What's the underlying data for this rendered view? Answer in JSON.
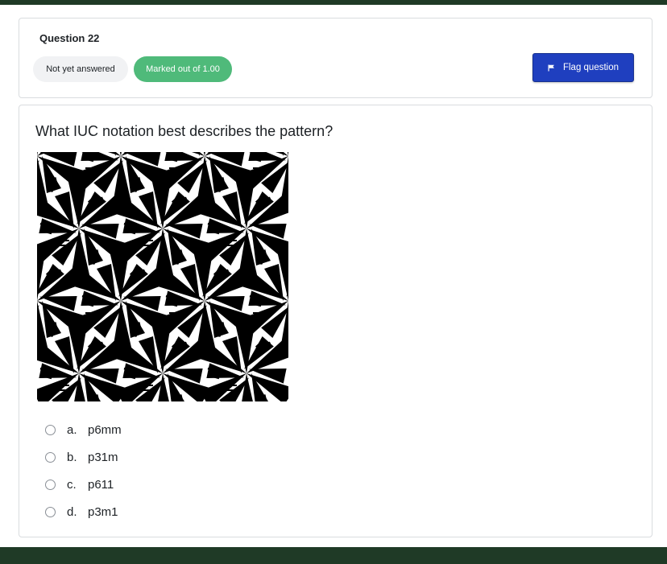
{
  "question": {
    "title": "Question 22",
    "state": "Not yet answered",
    "mark": "Marked out of 1.00",
    "flag_label": "Flag question",
    "text": "What IUC notation best describes the pattern?"
  },
  "answers": [
    {
      "letter": "a.",
      "label": "p6mm"
    },
    {
      "letter": "b.",
      "label": "p31m"
    },
    {
      "letter": "c.",
      "label": "p611"
    },
    {
      "letter": "d.",
      "label": "p3m1"
    }
  ],
  "colors": {
    "brand_bar": "#1f3a26",
    "mark_badge": "#4fba7a",
    "flag_button": "#1f3fbf"
  },
  "icons": {
    "flag": "flag-icon",
    "radio": "radio-circle"
  }
}
